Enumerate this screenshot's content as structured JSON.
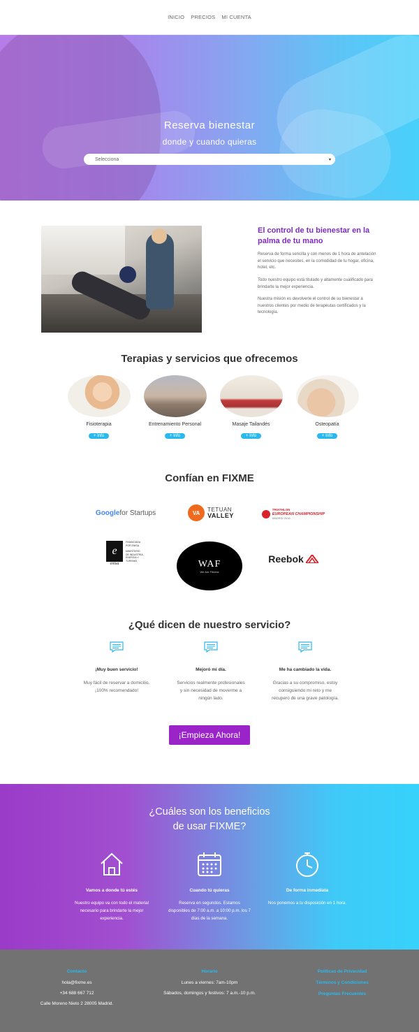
{
  "nav": {
    "items": [
      "INICIO",
      "PRECIOS",
      "MI CUENTA"
    ]
  },
  "hero": {
    "title": "Reserva bienestar",
    "subtitle": "donde y cuando quieras",
    "select_value": "Selecciona"
  },
  "intro": {
    "title": "El control de tu bienestar en la palma de tu mano",
    "paragraphs": [
      "Reserva de forma sencilla y con menos de 1 hora de antelación el servicio que necesites, en la comodidad de tu hogar, oficina, hotel, etc.",
      "Todo nuestro equipo está titulado y altamente cualificado para brindarte la mejor experiencia.",
      "Nuestra misión es devolverle el control de su bienestar a nuestros clientes por medio de terapeutas certificados y la tecnología."
    ]
  },
  "services": {
    "title": "Terapias y servicios que ofrecemos",
    "items": [
      {
        "label": "Fisioterapia",
        "button": "+ Info"
      },
      {
        "label": "Entrenamiento Personal",
        "button": "+ Info"
      },
      {
        "label": "Masaje Tailandés",
        "button": "+ Info"
      },
      {
        "label": "Osteopatía",
        "button": "+ Info"
      }
    ]
  },
  "partners": {
    "title": "Confían en FIXME",
    "google": {
      "g1": "Google",
      "g2": " for Startups"
    },
    "tetuan": {
      "mark": "VA",
      "line1": "TETUAN",
      "line2": "VALLEY"
    },
    "triathlon": {
      "line1": "TRIATHLON",
      "line2": "EUROPEAN CHAMPIONSHIP",
      "line3": "MADRID 2018"
    },
    "enisa": {
      "mark": "e",
      "name": "enisa",
      "caption": "FINANCIADA POR ENISA",
      "ministry": "MINISTERIO DE INDUSTRIA, ENERGÍA Y TURISMO"
    },
    "waf": {
      "mark": "WAF",
      "tagline": "We Are Fitness"
    },
    "reebok": "Reebok"
  },
  "testimonials": {
    "title": "¿Qué dicen de nuestro servicio?",
    "items": [
      {
        "title": "¡Muy buen servicio!",
        "body": "Muy fácil de reservar a domicilio. ¡100% recomendado!"
      },
      {
        "title": "Mejoró mi día.",
        "body": "Servicios realmente profesionales y sin necesidad de moverme a ningún lado."
      },
      {
        "title": "Me ha cambiado la vida.",
        "body": "Gracias a su compromiso, estoy consiguiendo mi reto y me recupero de una grave patología."
      }
    ]
  },
  "cta": "¡Empieza Ahora!",
  "benefits": {
    "title_line1": "¿Cuáles son los beneficios",
    "title_line2": "de usar FIXME?",
    "items": [
      {
        "icon": "home-icon",
        "title": "Vamos a donde tú estés",
        "body": "Nuestro equipo va con todo el material necesario para brindarte la mejor experiencia."
      },
      {
        "icon": "calendar-icon",
        "title": "Cuando tú quieras",
        "body": "Reserva en segundos. Estamos disponibles de 7:00 a.m. a 10:00 p.m. los 7 días de la semana."
      },
      {
        "icon": "clock-icon",
        "title": "De forma inmediata",
        "body": "Nos ponemos a tu disposición en 1 hora."
      }
    ]
  },
  "footer": {
    "contact": {
      "heading": "Contacto",
      "email": "hola@fixme.es",
      "phone": "+34 688 667 712",
      "address": "Calle Moreno Nieto 2 28005 Madrid."
    },
    "hours": {
      "heading": "Horario",
      "weekdays": "Lunes a viernes: 7am-10pm",
      "weekend": "Sábados, domingos y festivos: 7 a.m.-10 p.m."
    },
    "links": [
      "Políticas de Privacidad",
      "Términos y Condiciones",
      "Preguntas Frecuentes"
    ]
  },
  "colors": {
    "accent_purple": "#9b24c9",
    "accent_cyan": "#29b9ef",
    "heading_purple": "#7e2bc4",
    "footer_gray": "#727272"
  }
}
